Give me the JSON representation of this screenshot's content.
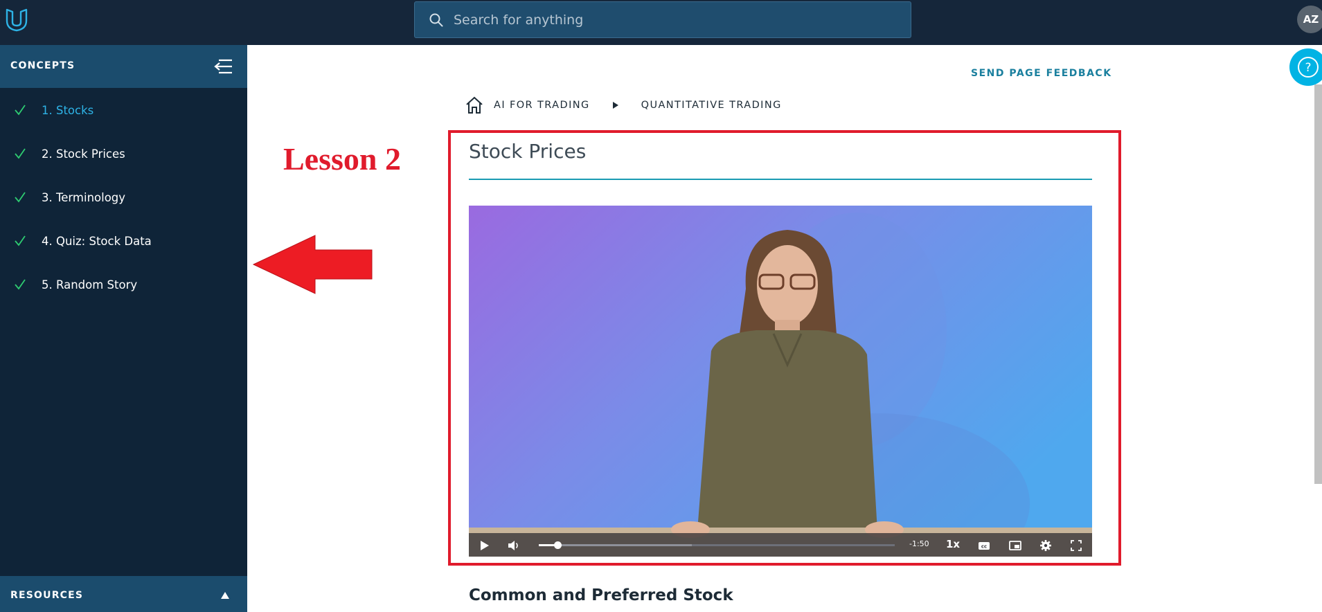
{
  "topbar": {
    "search_placeholder": "Search for anything",
    "avatar_initials": "AZ",
    "logo_icon": "udacity-logo-icon"
  },
  "sidebar": {
    "header_label": "CONCEPTS",
    "collapse_icon": "collapse-menu-icon",
    "items": [
      {
        "label": "1. Stocks",
        "completed": true,
        "active": true
      },
      {
        "label": "2. Stock Prices",
        "completed": true,
        "active": false
      },
      {
        "label": "3. Terminology",
        "completed": true,
        "active": false
      },
      {
        "label": "4. Quiz: Stock Data",
        "completed": true,
        "active": false
      },
      {
        "label": "5. Random Story",
        "completed": true,
        "active": false
      }
    ],
    "resources_label": "RESOURCES"
  },
  "main": {
    "feedback_label": "SEND PAGE FEEDBACK",
    "breadcrumb": [
      "AI FOR TRADING",
      "QUANTITATIVE TRADING"
    ],
    "lesson_title": "Stock Prices",
    "section_heading": "Common and Preferred Stock"
  },
  "video": {
    "time_remaining": "-1:50",
    "speed": "1x",
    "played_fraction": 0.05,
    "buffered_fraction": 0.43
  },
  "annotation": {
    "label": "Lesson 2",
    "color": "#e01b2c"
  },
  "colors": {
    "topbar": "#15263a",
    "sidebar": "#0f2438",
    "sidebar_header": "#1b4c6d",
    "accent": "#02b3e4",
    "check": "#2ecc71"
  }
}
